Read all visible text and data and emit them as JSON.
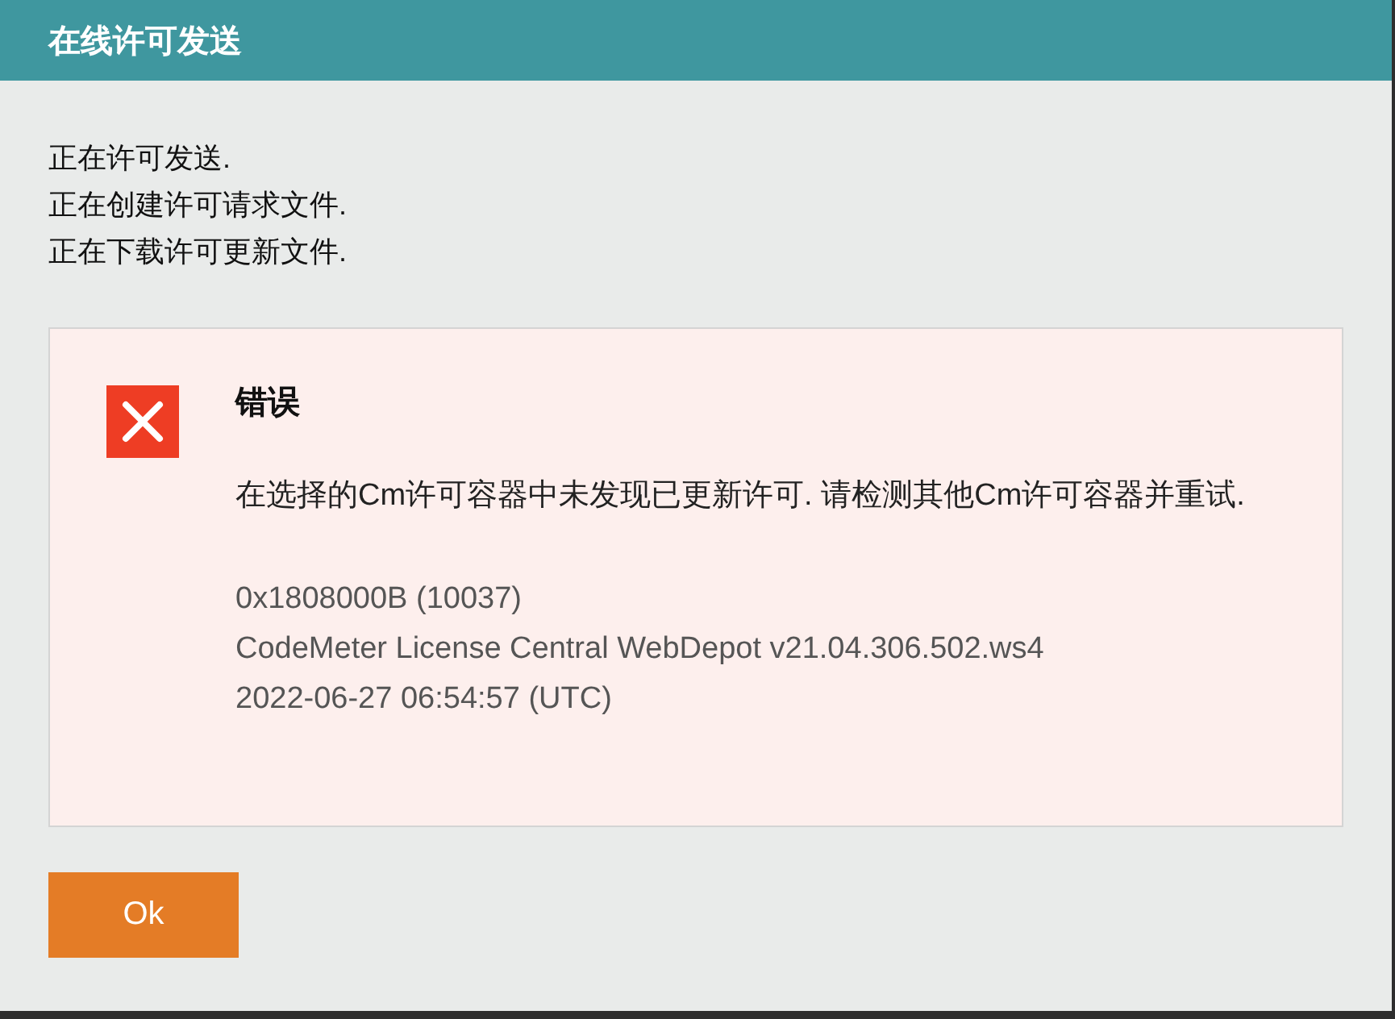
{
  "window": {
    "title": "在线许可发送"
  },
  "progress_messages": [
    "正在许可发送.",
    "正在创建许可请求文件.",
    "正在下载许可更新文件."
  ],
  "alert": {
    "kind": "error",
    "title": "错误",
    "message": "在选择的Cm许可容器中未发现已更新许可. 请检测其他Cm许可容器并重试.",
    "details": [
      "0x1808000B (10037)",
      "CodeMeter License Central WebDepot v21.04.306.502.ws4",
      "2022-06-27 06:54:57 (UTC)"
    ]
  },
  "buttons": [
    "Ok"
  ]
}
